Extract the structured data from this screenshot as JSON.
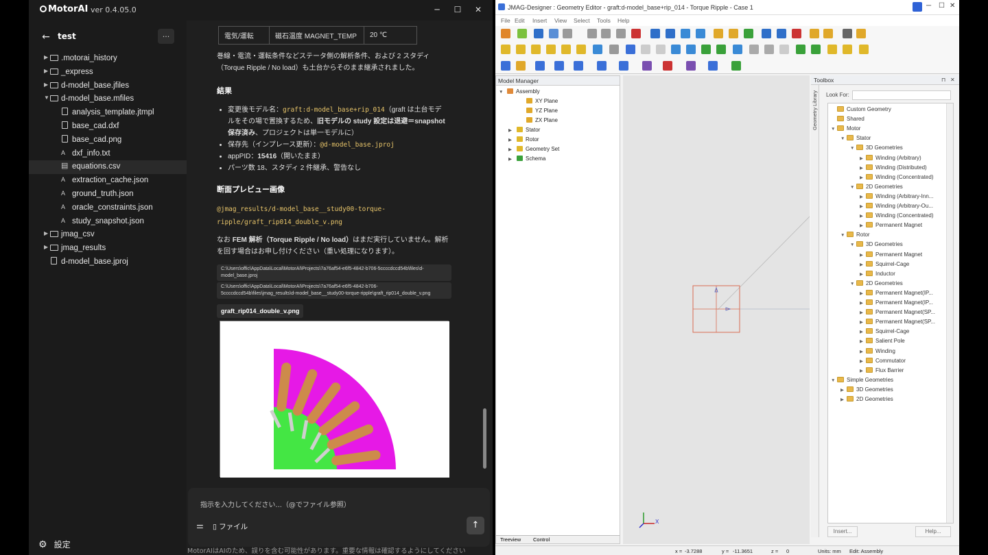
{
  "motorai": {
    "logo": "MotorAI",
    "version": "ver 0.4.05.0",
    "project": "test",
    "more_label": "...",
    "settings_label": "設定",
    "tree": [
      {
        "label": ".motorai_history",
        "type": "folder",
        "expanded": false,
        "level": 0
      },
      {
        "label": "_express",
        "type": "folder",
        "expanded": false,
        "level": 0
      },
      {
        "label": "d-model_base.jfiles",
        "type": "folder",
        "expanded": false,
        "level": 0
      },
      {
        "label": "d-model_base.mfiles",
        "type": "folder",
        "expanded": true,
        "level": 0
      },
      {
        "label": "analysis_template.jtmpl",
        "type": "file",
        "level": 1
      },
      {
        "label": "base_cad.dxf",
        "type": "file",
        "level": 1
      },
      {
        "label": "base_cad.png",
        "type": "image",
        "level": 1
      },
      {
        "label": "dxf_info.txt",
        "type": "text",
        "level": 1
      },
      {
        "label": "equations.csv",
        "type": "table",
        "level": 1,
        "selected": true
      },
      {
        "label": "extraction_cache.json",
        "type": "text",
        "level": 1
      },
      {
        "label": "ground_truth.json",
        "type": "text",
        "level": 1
      },
      {
        "label": "oracle_constraints.json",
        "type": "text",
        "level": 1
      },
      {
        "label": "study_snapshot.json",
        "type": "text",
        "level": 1
      },
      {
        "label": "jmag_csv",
        "type": "folder",
        "expanded": false,
        "level": 0
      },
      {
        "label": "jmag_results",
        "type": "folder",
        "expanded": false,
        "level": 0
      },
      {
        "label": "d-model_base.jproj",
        "type": "file",
        "level": 0
      }
    ],
    "chat": {
      "table_row": [
        "電気/運転",
        "磁石温度 MAGNET_TEMP",
        "20 ℃"
      ],
      "para1": "巻線・電流・運転条件などステータ側の解析条件、および 2 スタディ（Torque Ripple / No load）も土台からそのまま継承されました。",
      "result_heading": "結果",
      "bullet1_prefix": "変更後モデル名：",
      "bullet1_code": "graft:d-model_base+rip_014",
      "bullet1_suffix": "（graft は土台モデルをその場で置換するため、",
      "bullet1_bold": "旧モデルの study 設定は退避＝snapshot 保存済み",
      "bullet1_end": "、プロジェクトは単一モデルに）",
      "bullet2_prefix": "保存先（インプレース更新）：",
      "bullet2_code": "@d-model_base.jproj",
      "bullet3_prefix": "appPID：",
      "bullet3_bold": "15416",
      "bullet3_suffix": "（開いたまま）",
      "bullet4": "パーツ数 18、スタディ 2 件継承、警告なし",
      "preview_heading": "断面プレビュー画像",
      "preview_path": "@jmag_results/d-model_base__study00-torque-ripple/graft_rip014_double_v.png",
      "note_prefix": "なお ",
      "note_bold": "FEM 解析（Torque Ripple / No load）",
      "note_suffix": "はまだ実行していません。解析を回す場合はお申し付けください（重い処理になります）。",
      "path1": "C:\\Users\\offic\\AppData\\Local\\MotorAI\\Projects\\7a76af54-e6f5-4842-b706-5ccccdccd54b\\files\\d-model_base.jproj",
      "path2": "C:\\Users\\offic\\AppData\\Local\\MotorAI\\Projects\\7a76af54-e6f5-4842-b706-5ccccdccd54b\\files\\jmag_results\\d-model_base__study00-torque-ripple\\graft_rip014_double_v.png",
      "image_tag": "graft_rip014_double_v.png"
    },
    "input_placeholder": "指示を入力してください...（@でファイル参照）",
    "attach_label": "ファイル",
    "disclaimer": "MotorAIはAIのため、誤りを含む可能性があります。重要な情報は確認するようにしてください",
    "colors": {
      "stator_magenta": "#e619e6",
      "rotor_green": "#44e644",
      "coil_brown": "#cd8b4b"
    }
  },
  "jmag": {
    "title": "JMAG-Designer : Geometry Editor - graft:d-model_base+rip_014 - Torque Ripple - Case 1",
    "menu": [
      "File",
      "Edit",
      "Insert",
      "View",
      "Select",
      "Tools",
      "Help"
    ],
    "model_manager": {
      "header": "Model Manager",
      "items": [
        "Assembly",
        "XY Plane",
        "YZ Plane",
        "ZX Plane",
        "Stator",
        "Rotor",
        "Geometry Set",
        "Schema"
      ],
      "tabs": [
        "Treeview",
        "Control"
      ]
    },
    "library_tab": "Geometry Library",
    "toolbox": {
      "header": "Toolbox",
      "look_for": "Look For:",
      "items": [
        "Custom Geometry",
        "Shared",
        "Motor",
        "Stator",
        "3D Geometries",
        "Winding (Arbitrary)",
        "Winding (Distributed)",
        "Winding (Concentrated)",
        "2D Geometries",
        "Winding (Arbitrary-Inn...",
        "Winding (Arbitrary-Ou...",
        "Winding (Concentrated)",
        "Permanent Magnet",
        "Rotor",
        "3D Geometries",
        "Permanent Magnet",
        "Squirrel-Cage",
        "Inductor",
        "2D Geometries",
        "Permanent Magnet(IP...",
        "Permanent Magnet(IP...",
        "Permanent Magnet(SP...",
        "Permanent Magnet(SP...",
        "Squirrel-Cage",
        "Salient Pole",
        "Winding",
        "Commutator",
        "Flux Barrier",
        "Simple Geometries",
        "3D Geometries",
        "2D Geometries"
      ],
      "insert_label": "Insert...",
      "help_label": "Help..."
    },
    "status": {
      "x_label": "x =",
      "x_value": "-3.7288",
      "y_label": "y =",
      "y_value": "-11.3651",
      "z_label": "z =",
      "z_value": "0",
      "units": "Units: mm",
      "edit": "Edit: Assembly"
    },
    "axis_x": "X"
  }
}
